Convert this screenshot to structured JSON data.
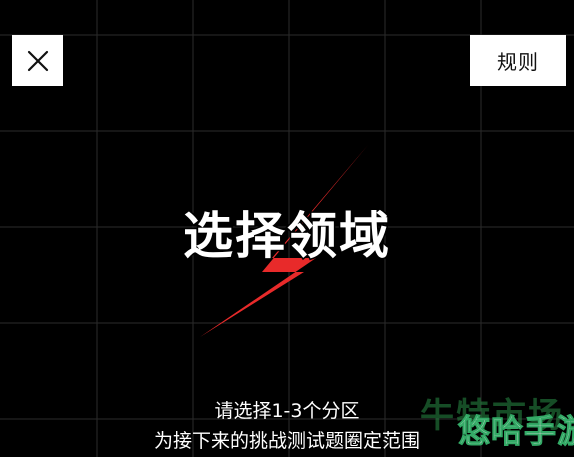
{
  "header": {
    "close_label": "✕",
    "rules_label": "规则"
  },
  "main": {
    "title": "选择领域",
    "hint_line1": "请选择1-3个分区",
    "hint_line2": "为接下来的挑战测试题圈定范围"
  },
  "watermark": {
    "back_text": "牛特市场",
    "front_text": "悠哈手游"
  },
  "colors": {
    "background": "#000000",
    "accent_bolt": "#e82a2a",
    "grid": "#2a2a2a",
    "button_bg": "#ffffff"
  }
}
